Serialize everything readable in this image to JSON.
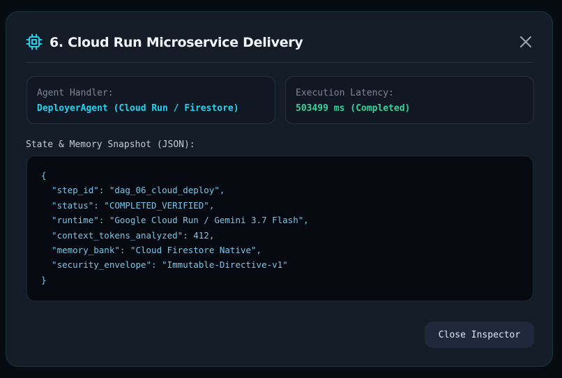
{
  "modal": {
    "title": "6. Cloud Run Microservice Delivery",
    "icon": "cpu-chip-icon",
    "close_icon": "close-icon",
    "accent_color": "#22d3ee"
  },
  "agent_card": {
    "label": "Agent Handler:",
    "value": "DeployerAgent (Cloud Run / Firestore)"
  },
  "latency_card": {
    "label": "Execution Latency:",
    "value": "503499 ms (Completed)",
    "value_color": "#34d399"
  },
  "snapshot": {
    "label": "State & Memory Snapshot (JSON):",
    "lines": [
      "{",
      "  \"step_id\": \"dag_06_cloud_deploy\",",
      "  \"status\": \"COMPLETED_VERIFIED\",",
      "  \"runtime\": \"Google Cloud Run / Gemini 3.7 Flash\",",
      "  \"context_tokens_analyzed\": 412,",
      "  \"memory_bank\": \"Cloud Firestore Native\",",
      "  \"security_envelope\": \"Immutable-Directive-v1\"",
      "}"
    ]
  },
  "footer": {
    "close_label": "Close Inspector"
  }
}
